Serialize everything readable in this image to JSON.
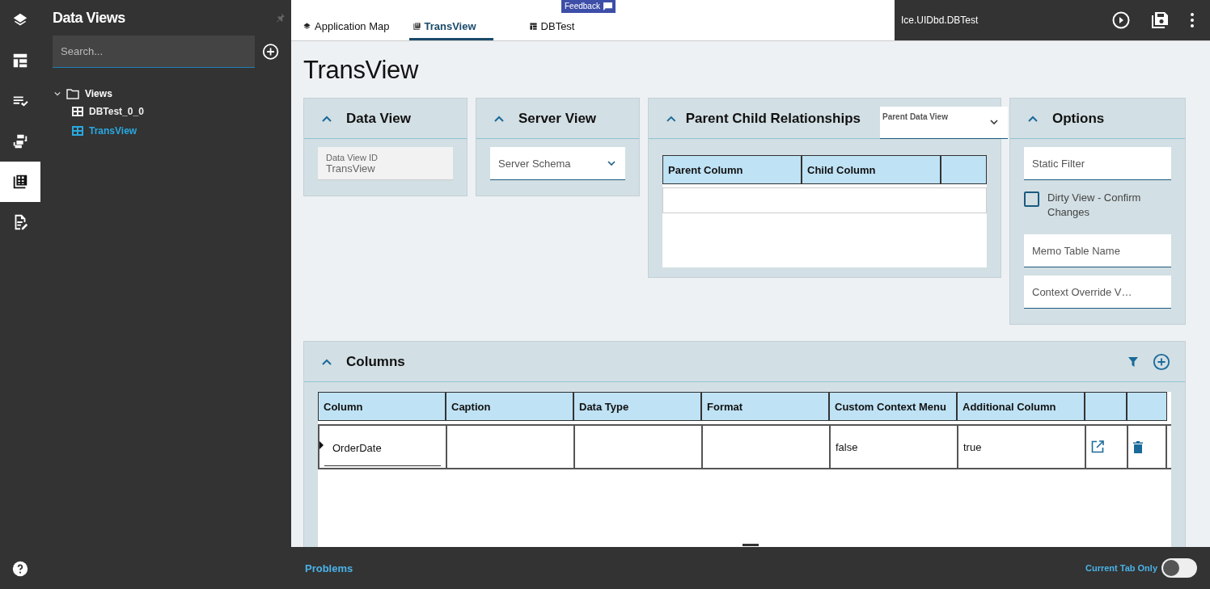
{
  "rail": {
    "items": [
      {
        "kind": "layers",
        "selected": false
      },
      {
        "kind": "layout",
        "selected": false
      },
      {
        "kind": "checklist",
        "selected": false
      },
      {
        "kind": "flow",
        "selected": false
      },
      {
        "kind": "table",
        "selected": true
      },
      {
        "kind": "edit",
        "selected": false
      }
    ]
  },
  "sidebar": {
    "title": "Data Views",
    "search": {
      "placeholder": "Search..."
    },
    "tree": [
      {
        "label": "Views",
        "expanded": true,
        "children": [
          {
            "label": "DBTest_0_0",
            "selected": false
          },
          {
            "label": "TransView",
            "selected": true
          }
        ]
      }
    ]
  },
  "tabs": [
    {
      "label": "Application Map",
      "kind": "layers",
      "selected": false
    },
    {
      "label": "TransView",
      "kind": "table",
      "selected": true
    },
    {
      "label": "DBTest",
      "kind": "layout",
      "selected": false
    }
  ],
  "feedback": "Feedback",
  "project": "Ice.UIDbd.DBTest",
  "page_title": "TransView",
  "data_view": {
    "title": "Data View",
    "expanded": true,
    "field": {
      "label": "Data View ID",
      "value": "TransView"
    }
  },
  "server_view": {
    "title": "Server View",
    "expanded": true,
    "select": {
      "placeholder": "Server Schema"
    }
  },
  "relationships": {
    "title": "Parent Child Relationships",
    "expanded": true,
    "select": {
      "label": "Parent Data View"
    },
    "columns": [
      "Parent Column",
      "Child Column"
    ]
  },
  "options": {
    "title": "Options",
    "expanded": true,
    "static_filter": {
      "placeholder": "Static Filter"
    },
    "dirty_view": {
      "label": "Dirty View - Confirm Changes",
      "checked": false
    },
    "memo_table": {
      "placeholder": "Memo Table Name"
    },
    "context_override": {
      "placeholder": "Context Override V…"
    }
  },
  "columns": {
    "title": "Columns",
    "expanded": true,
    "headers": [
      "Column",
      "Caption",
      "Data Type",
      "Format",
      "Custom Context Menu",
      "Additional Column"
    ],
    "rows": [
      {
        "current": true,
        "column": "OrderDate",
        "custom_context_menu": "false",
        "additional_column": "true"
      }
    ]
  },
  "bottom": {
    "problems": "Problems",
    "current_tab_only": {
      "label": "Current Tab Only",
      "on": false
    }
  }
}
